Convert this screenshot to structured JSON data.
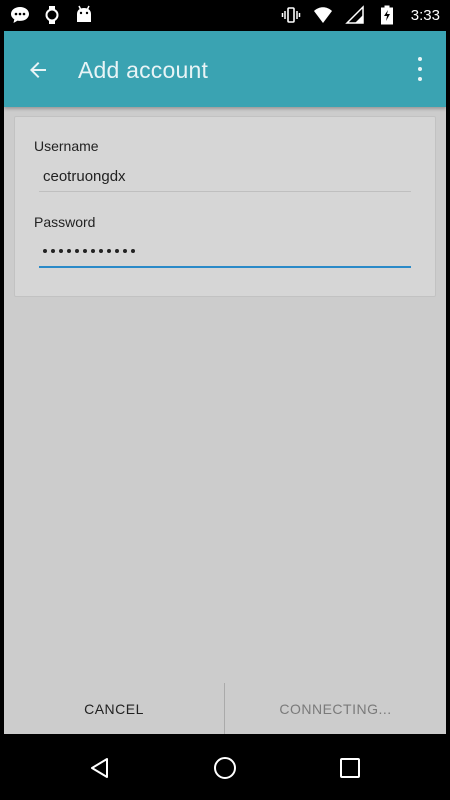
{
  "status_bar": {
    "time": "3:33",
    "left_icons": [
      "chat-bubble-icon",
      "watch-icon",
      "android-icon"
    ],
    "right_icons": [
      "vibrate-icon",
      "wifi-icon",
      "signal-icon",
      "battery-charging-icon"
    ]
  },
  "app_bar": {
    "title": "Add account",
    "back_icon": "arrow-back-icon",
    "overflow_icon": "more-vert-icon",
    "color": "#3aa3b2"
  },
  "form": {
    "username_label": "Username",
    "username_value": "ceotruongdx",
    "password_label": "Password",
    "password_dot_count": 12
  },
  "actions": {
    "cancel_label": "CANCEL",
    "next_label": "CONNECTING..."
  },
  "nav_bar": {
    "icons": [
      "back-triangle-icon",
      "home-circle-icon",
      "recents-square-icon"
    ]
  }
}
